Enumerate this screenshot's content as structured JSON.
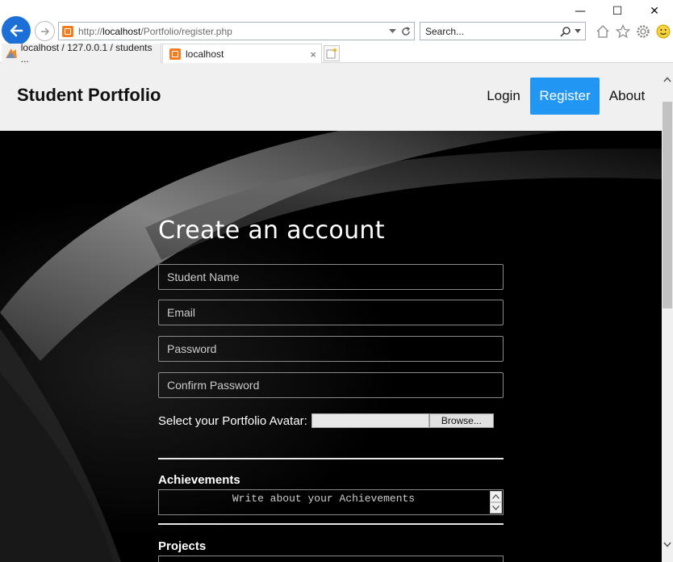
{
  "browser": {
    "window_controls": {
      "minimize": "—",
      "maximize": "☐",
      "close": "✕"
    },
    "address": {
      "prefix": "http://",
      "host": "localhost",
      "path": "/Portfolio/register.php"
    },
    "search": {
      "placeholder": "Search..."
    },
    "tabs": [
      {
        "label": "localhost / 127.0.0.1 / students ...",
        "active": false
      },
      {
        "label": "localhost",
        "active": true
      }
    ],
    "tab_close": "×",
    "icons": [
      "back-icon",
      "forward-icon",
      "home-icon",
      "favorites-star-icon",
      "settings-gear-icon",
      "smiley-feedback-icon"
    ]
  },
  "navbar": {
    "brand": "Student Portfolio",
    "links": {
      "login": "Login",
      "register": "Register",
      "about": "About"
    },
    "active_color": "#2196f3"
  },
  "form": {
    "title": "Create an account",
    "fields": {
      "student_name": "Student Name",
      "email": "Email",
      "password": "Password",
      "confirm_password": "Confirm Password"
    },
    "avatar_label": "Select your Portfolio Avatar:",
    "browse_label": "Browse...",
    "achievements_label": "Achievements",
    "achievements_placeholder": "Write about your Achievements",
    "projects_label": "Projects"
  },
  "colors": {
    "hero_background": "#000000",
    "navbar_background": "#f0f0f0",
    "accent": "#2196f3",
    "browser_back": "#1c6fd6"
  }
}
